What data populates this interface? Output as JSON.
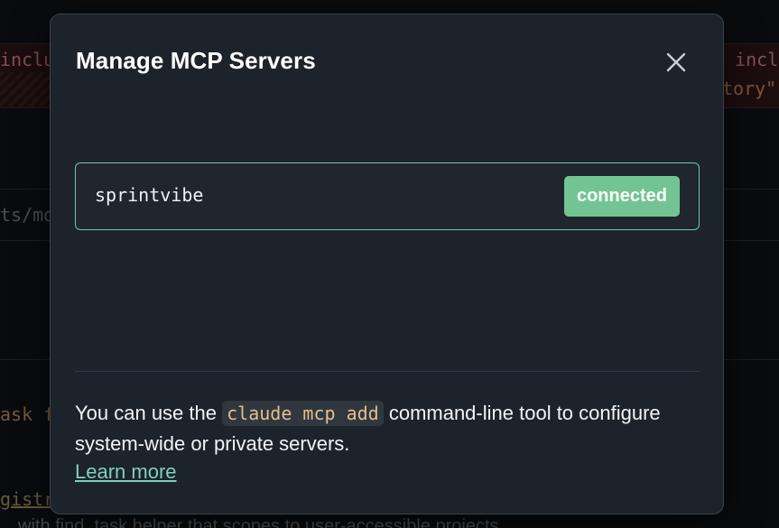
{
  "background": {
    "code_fragments": [
      "inclu",
      "o incl",
      "tory\",",
      "ts/mo",
      "ask f",
      "gistry",
      "with  find_task  helper that scopes to user-accessible projects"
    ]
  },
  "modal": {
    "title": "Manage MCP Servers",
    "close_icon": "close-icon",
    "servers": [
      {
        "name": "sprintvibe",
        "status": "connected"
      }
    ],
    "footer": {
      "prefix": "You can use the",
      "command": "claude mcp add",
      "suffix": "command-line tool to configure system-wide or private servers.",
      "link": "Learn more"
    }
  },
  "colors": {
    "accent": "#6fc6b0",
    "connected": "#72c592",
    "link": "#7fd0bd"
  }
}
